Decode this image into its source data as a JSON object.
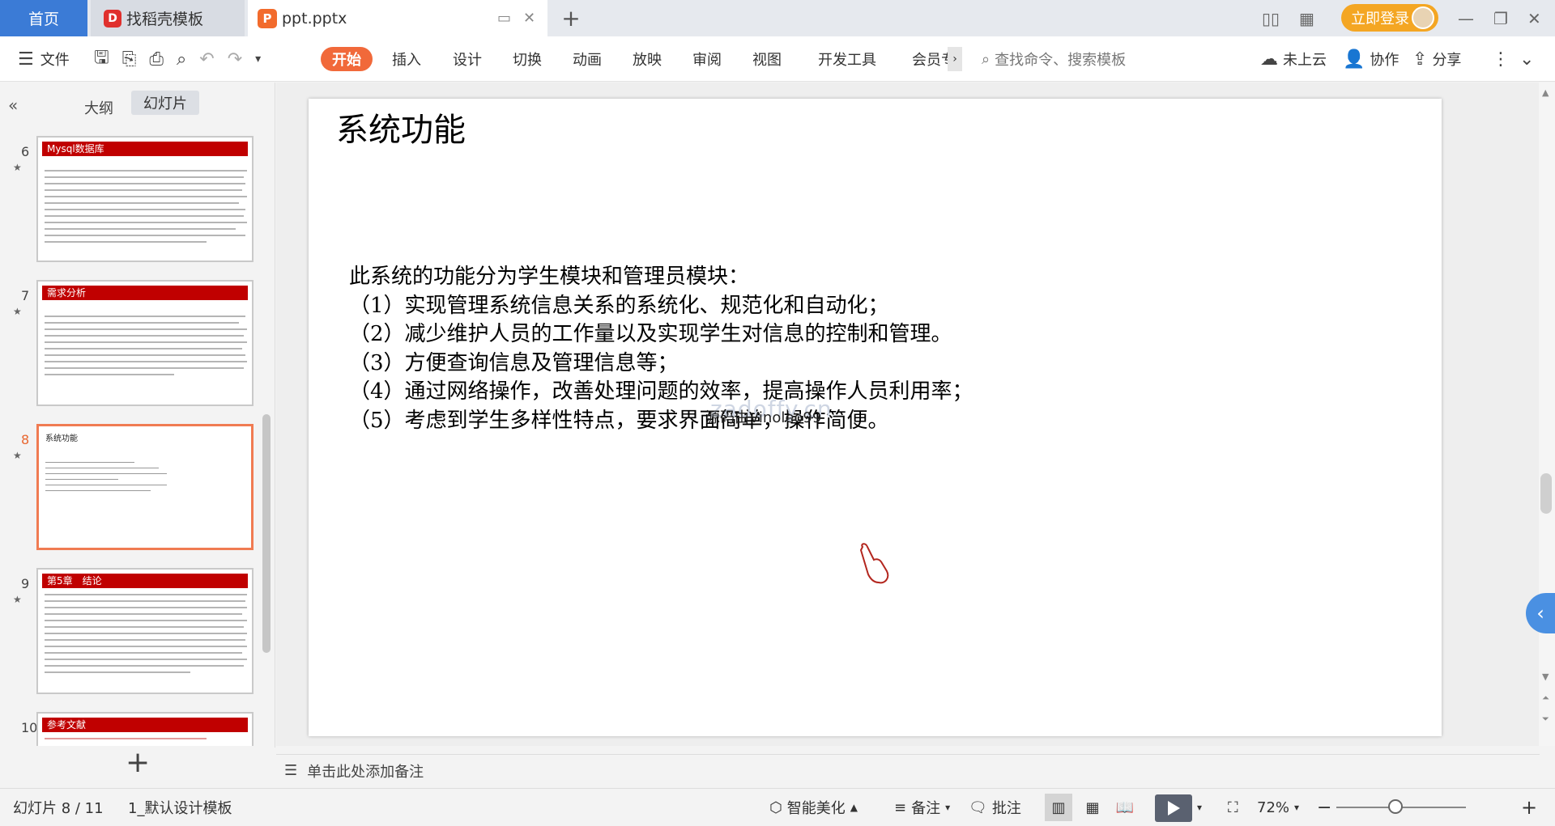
{
  "tabs": {
    "home": "首页",
    "docer": "找稻壳模板",
    "docer_logo": "D",
    "file": "ppt.pptx",
    "file_logo": "P",
    "add": "+"
  },
  "window": {
    "login": "立即登录"
  },
  "ribbon": {
    "file_menu": "文件",
    "tabs": [
      "开始",
      "插入",
      "设计",
      "切换",
      "动画",
      "放映",
      "审阅",
      "视图",
      "开发工具",
      "会员专"
    ],
    "search_placeholder": "查找命令、搜索模板",
    "cloud": "未上云",
    "collab": "协作",
    "share": "分享"
  },
  "left_panel": {
    "outline_tab": "大纲",
    "slides_tab": "幻灯片",
    "thumbnails": [
      {
        "num": "6",
        "title": "Mysql数据库"
      },
      {
        "num": "7",
        "title": "需求分析"
      },
      {
        "num": "8",
        "title": "系统功能",
        "selected": true
      },
      {
        "num": "9",
        "title": "第5章　结论"
      },
      {
        "num": "10",
        "title": "参考文献"
      }
    ]
  },
  "slide": {
    "title": "系统功能",
    "body_lines": [
      "此系统的功能分为学生模块和管理员模块：",
      "（1）实现管理系统信息关系的系统化、规范化和自动化；",
      "（2）减少维护人员的工作量以及实现学生对信息的控制和管理。",
      "（3）方便查询信息及管理信息等；",
      "（4）通过网络操作，改善处理问题的效率，提高操作人员利用率；",
      "（5）考虑到学生多样性特点，要求界面简单，操作简便。"
    ],
    "watermark": "zadoffy.cn",
    "overlay_text": "源码由Vinoleo99"
  },
  "notes": {
    "placeholder": "单击此处添加备注"
  },
  "status": {
    "slide_counter": "幻灯片 8 / 11",
    "template": "1_默认设计模板",
    "smart_beautify": "智能美化",
    "notes": "备注",
    "comments": "批注",
    "zoom": "72%"
  }
}
